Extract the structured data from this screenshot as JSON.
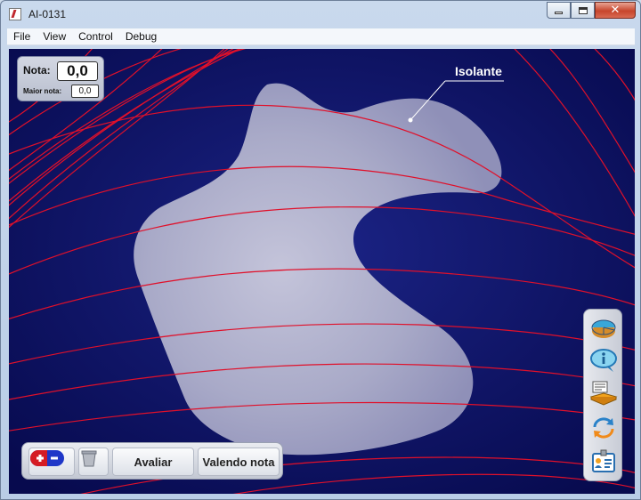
{
  "window": {
    "title": "AI-0131"
  },
  "menu": {
    "items": [
      "File",
      "View",
      "Control",
      "Debug"
    ]
  },
  "score": {
    "label": "Nota:",
    "value": "0,0",
    "best_label": "Maior nota:",
    "best_value": "0,0"
  },
  "canvas": {
    "insulator_label": "Isolante"
  },
  "toolbar": {
    "evaluate_label": "Avaliar",
    "worth_label": "Valendo nota"
  },
  "side_tools": [
    "charts-icon",
    "info-icon",
    "instructions-book-icon",
    "reset-arrows-icon",
    "credits-badge-icon"
  ],
  "colors": {
    "background": "#0a0e5c",
    "field_lines": "#e0102a",
    "insulator": "#b9b9d3"
  }
}
